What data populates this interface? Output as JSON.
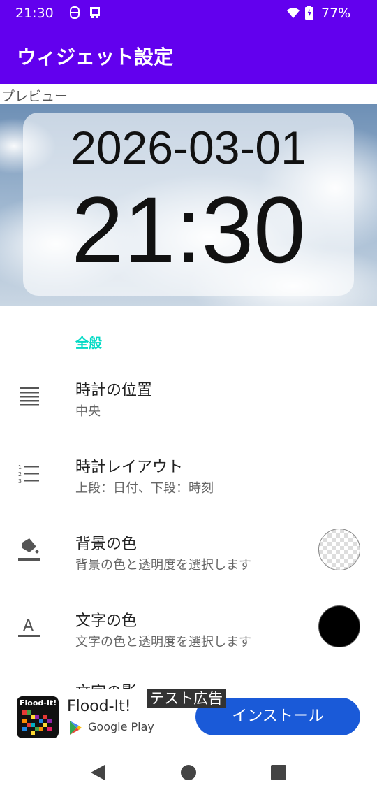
{
  "status_bar": {
    "time": "21:30",
    "battery_percent": "77%"
  },
  "app_bar": {
    "title": "ウィジェット設定"
  },
  "preview": {
    "label": "プレビュー",
    "date": "2026-03-01",
    "time": "21:30"
  },
  "settings": {
    "section_general": "全般",
    "items": [
      {
        "title": "時計の位置",
        "summary": "中央",
        "icon": "align-icon"
      },
      {
        "title": "時計レイアウト",
        "summary": "上段：日付、下段：時刻",
        "icon": "numbered-list-icon"
      },
      {
        "title": "背景の色",
        "summary": "背景の色と透明度を選択します",
        "icon": "paint-bucket-icon",
        "swatch": "transparent"
      },
      {
        "title": "文字の色",
        "summary": "文字の色と透明度を選択します",
        "icon": "text-color-icon",
        "swatch": "#000000"
      },
      {
        "title": "文字の影",
        "summary": ""
      }
    ]
  },
  "ad": {
    "test_label": "テスト広告",
    "app_name": "Flood-It!",
    "icon_text": "Flood-It!",
    "store": "Google Play",
    "install_label": "インストール"
  },
  "colors": {
    "primary": "#6200ee",
    "accent": "#03dac5",
    "install_button": "#1a5ad8"
  }
}
